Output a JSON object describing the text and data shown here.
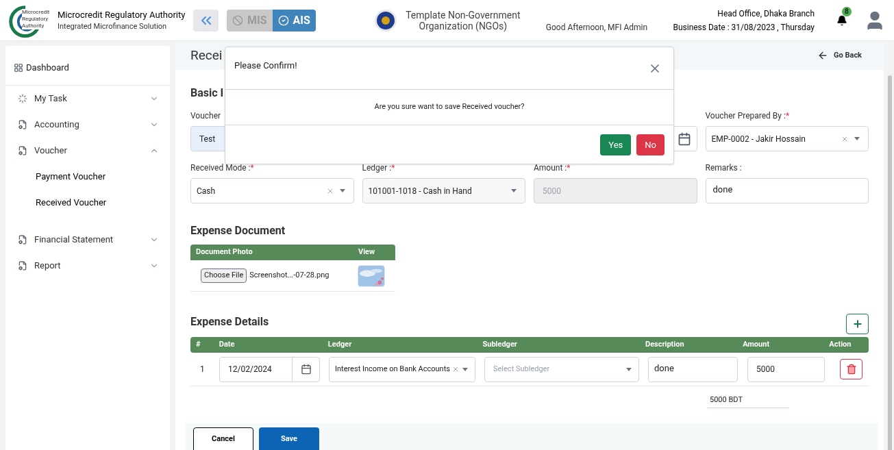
{
  "header": {
    "org_title": "Microcredit Regulatory Authority",
    "org_subtitle": "Integrated Microfinance Solution",
    "logo_text": [
      "Microcredit",
      "Regulatory",
      "Authority"
    ],
    "modes": [
      {
        "label": "MIS",
        "selected": false
      },
      {
        "label": "AIS",
        "selected": true
      }
    ],
    "ngo_name": "Template Non-Government Organization (NGOs)",
    "greeting": "Good Afternoon, MFI Admin",
    "branch": "Head Office, Dhaka Branch",
    "business_date": "Business Date : 31/08/2023 , Thursday",
    "notification_count": "8"
  },
  "sidebar": {
    "items": [
      {
        "kind": "dashboard",
        "label": "Dashboard"
      },
      {
        "kind": "task",
        "label": "My Task",
        "expanded": false
      },
      {
        "kind": "doc",
        "label": "Accounting",
        "expanded": false
      },
      {
        "kind": "doc",
        "label": "Voucher",
        "expanded": true,
        "children": [
          {
            "label": "Payment Voucher"
          },
          {
            "label": "Received Voucher"
          }
        ]
      },
      {
        "kind": "doc",
        "label": "Financial Statement",
        "expanded": false
      },
      {
        "kind": "doc",
        "label": "Report",
        "expanded": false
      }
    ]
  },
  "page": {
    "title": "Recei",
    "go_back": "Go Back",
    "section_basic": "Basic I",
    "required_mark": "*",
    "row1": [
      {
        "kind": "text",
        "label": "Voucher",
        "value": "Test"
      },
      {
        "kind": "hidden"
      },
      {
        "kind": "date"
      },
      {
        "kind": "select",
        "label": "Voucher Prepared By :",
        "required": true,
        "value": "EMP-0002 - Jakir Hossain"
      }
    ],
    "row2": [
      {
        "kind": "select",
        "label": "Received Mode :",
        "required": true,
        "value": "Cash"
      },
      {
        "kind": "dropdown",
        "label": "Ledger :",
        "required": true,
        "value": "101001-1018 - Cash in Hand"
      },
      {
        "kind": "disabled",
        "label": "Amount :",
        "required": true,
        "value": "5000"
      },
      {
        "kind": "textarea",
        "label": "Remarks :",
        "required": false,
        "value": "done"
      }
    ],
    "document": {
      "title": "Expense Document",
      "columns": [
        "Document Photo",
        "View"
      ],
      "choose_file": "Choose File",
      "file_name": "Screenshot...-07-28.png"
    },
    "details": {
      "title": "Expense Details",
      "columns": [
        "#",
        "Date",
        "Ledger",
        "Subledger",
        "Description",
        "Amount",
        "Action"
      ],
      "rows": [
        {
          "index": "1",
          "date": "12/02/2024",
          "ledger": "Interest Income on Bank Accounts",
          "subledger_placeholder": "Select Subledger",
          "description": "done",
          "amount": "5000"
        }
      ],
      "total": "5000 BDT"
    },
    "buttons": [
      "Cancel",
      "Save"
    ]
  },
  "dialog": {
    "title": "Please Confirm!",
    "message": "Are you sure want to save Received voucher?",
    "buttons": [
      "Yes",
      "No"
    ]
  }
}
